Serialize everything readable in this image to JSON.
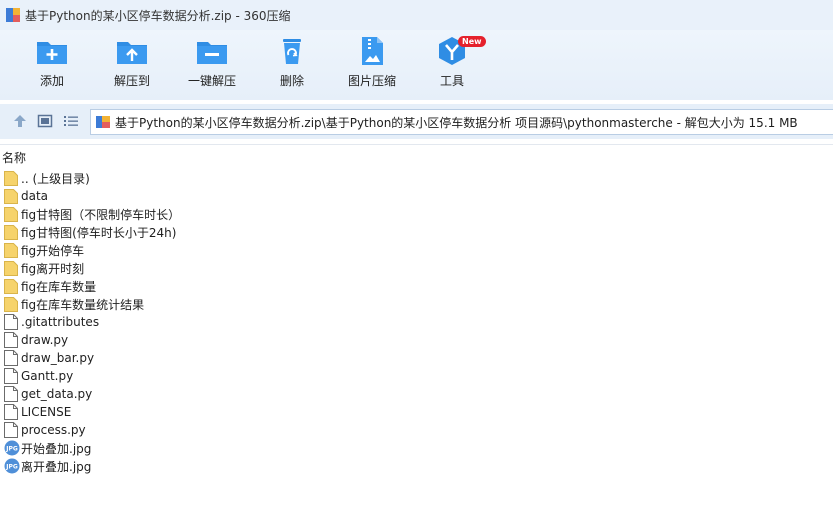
{
  "window": {
    "title": "基于Python的某小区停车数据分析.zip - 360压缩"
  },
  "toolbar": {
    "items": [
      {
        "label": "添加",
        "icon": "add-folder-icon"
      },
      {
        "label": "解压到",
        "icon": "extract-to-icon"
      },
      {
        "label": "一键解压",
        "icon": "one-click-extract-icon"
      },
      {
        "label": "删除",
        "icon": "recycle-bin-icon"
      },
      {
        "label": "图片压缩",
        "icon": "image-compress-icon"
      },
      {
        "label": "工具",
        "icon": "tools-icon",
        "badge": "New"
      }
    ]
  },
  "address": {
    "path": "基于Python的某小区停车数据分析.zip\\基于Python的某小区停车数据分析 项目源码\\pythonmasterche - 解包大小为 15.1 MB"
  },
  "list": {
    "column_name": "名称",
    "items": [
      {
        "name": ".. (上级目录)",
        "type": "folder"
      },
      {
        "name": "data",
        "type": "folder"
      },
      {
        "name": "fig甘特图（不限制停车时长）",
        "type": "folder"
      },
      {
        "name": "fig甘特图(停车时长小于24h)",
        "type": "folder"
      },
      {
        "name": "fig开始停车",
        "type": "folder"
      },
      {
        "name": "fig离开时刻",
        "type": "folder"
      },
      {
        "name": "fig在库车数量",
        "type": "folder"
      },
      {
        "name": "fig在库车数量统计结果",
        "type": "folder"
      },
      {
        "name": ".gitattributes",
        "type": "file"
      },
      {
        "name": "draw.py",
        "type": "file"
      },
      {
        "name": "draw_bar.py",
        "type": "file"
      },
      {
        "name": "Gantt.py",
        "type": "file"
      },
      {
        "name": "get_data.py",
        "type": "file"
      },
      {
        "name": "LICENSE",
        "type": "file"
      },
      {
        "name": "process.py",
        "type": "file"
      },
      {
        "name": "开始叠加.jpg",
        "type": "image"
      },
      {
        "name": "离开叠加.jpg",
        "type": "image"
      }
    ]
  },
  "colors": {
    "accent": "#2f8de4",
    "folder": "#f6d36b",
    "toolbar_bg": "#e6eff9",
    "badge": "#e5212c"
  }
}
